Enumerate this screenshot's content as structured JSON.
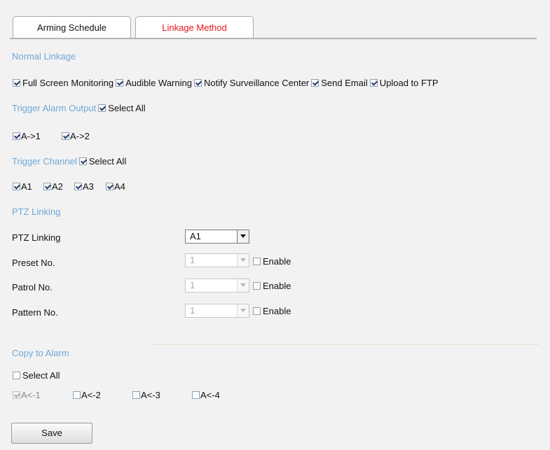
{
  "tabs": [
    "Arming Schedule",
    "Linkage Method"
  ],
  "active_tab": "Linkage Method",
  "colors": {
    "active_tab_text": "#e8141b",
    "section_heading": "#6fa6d8"
  },
  "normal_linkage": {
    "title": "Normal Linkage",
    "options": [
      {
        "label": "Full Screen Monitoring",
        "checked": true
      },
      {
        "label": "Audible Warning",
        "checked": true
      },
      {
        "label": "Notify Surveillance Center",
        "checked": true
      },
      {
        "label": "Send Email",
        "checked": true
      },
      {
        "label": "Upload to FTP",
        "checked": true
      }
    ]
  },
  "trigger_alarm_output": {
    "title": "Trigger Alarm Output",
    "select_all_label": "Select All",
    "select_all_checked": true,
    "items": [
      {
        "label": "A->1",
        "checked": true
      },
      {
        "label": "A->2",
        "checked": true
      }
    ]
  },
  "trigger_channel": {
    "title": "Trigger Channel",
    "select_all_label": "Select All",
    "select_all_checked": true,
    "items": [
      {
        "label": "A1",
        "checked": true
      },
      {
        "label": "A2",
        "checked": true
      },
      {
        "label": "A3",
        "checked": true
      },
      {
        "label": "A4",
        "checked": true
      }
    ]
  },
  "ptz": {
    "title": "PTZ Linking",
    "ptz_linking_label": "PTZ Linking",
    "ptz_linking_value": "A1",
    "preset_label": "Preset No.",
    "preset_value": "1",
    "patrol_label": "Patrol No.",
    "patrol_value": "1",
    "pattern_label": "Pattern No.",
    "pattern_value": "1",
    "enable_label": "Enable"
  },
  "copy_to_alarm": {
    "title": "Copy to Alarm",
    "select_all_label": "Select All",
    "select_all_checked": false,
    "items": [
      {
        "label": "A<-1",
        "checked": true,
        "disabled": true
      },
      {
        "label": "A<-2",
        "checked": false,
        "disabled": false
      },
      {
        "label": "A<-3",
        "checked": false,
        "disabled": false
      },
      {
        "label": "A<-4",
        "checked": false,
        "disabled": false
      }
    ]
  },
  "save_label": "Save"
}
